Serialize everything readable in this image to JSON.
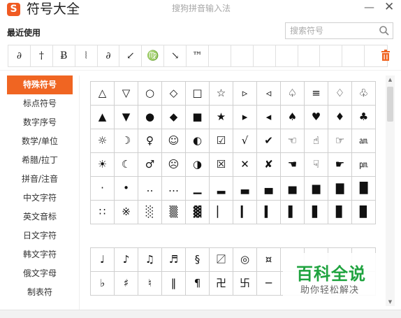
{
  "header": {
    "logo_letter": "S",
    "title": "符号大全",
    "ime_title": "搜狗拼音输入法",
    "minimize": "—",
    "close": "✕"
  },
  "recent": {
    "label": "最近使用",
    "items": [
      "∂",
      "†",
      "Ƀ",
      "⦚",
      "∂",
      "↙",
      "♍",
      "↘",
      "™",
      "",
      "",
      "",
      "",
      "",
      "",
      "",
      ""
    ]
  },
  "search": {
    "placeholder": "搜索符号",
    "value": ""
  },
  "sidebar": {
    "items": [
      {
        "label": "特殊符号",
        "active": true
      },
      {
        "label": "标点符号",
        "active": false
      },
      {
        "label": "数字序号",
        "active": false
      },
      {
        "label": "数学/单位",
        "active": false
      },
      {
        "label": "希腊/拉丁",
        "active": false
      },
      {
        "label": "拼音/注音",
        "active": false
      },
      {
        "label": "中文字符",
        "active": false
      },
      {
        "label": "英文音标",
        "active": false
      },
      {
        "label": "日文字符",
        "active": false
      },
      {
        "label": "韩文字符",
        "active": false
      },
      {
        "label": "俄文字母",
        "active": false
      },
      {
        "label": "制表符",
        "active": false
      }
    ]
  },
  "grid1": [
    "△",
    "▽",
    "○",
    "◇",
    "□",
    "☆",
    "▹",
    "◃",
    "♤",
    "≡",
    "♢",
    "♧",
    "▲",
    "▼",
    "●",
    "◆",
    "■",
    "★",
    "▸",
    "◂",
    "♠",
    "♥",
    "♦",
    "♣",
    "☼",
    "☽",
    "♀",
    "☺",
    "◐",
    "☑",
    "√",
    "✔",
    "☜",
    "☝",
    "☞",
    "㏂",
    "☀",
    "☾",
    "♂",
    "☹",
    "◑",
    "☒",
    "✕",
    "✘",
    "☚",
    "☟",
    "☛",
    "㏘",
    "‧",
    "•",
    "‥",
    "…",
    "▁",
    "▂",
    "▃",
    "▄",
    "▅",
    "▆",
    "▇",
    "█",
    "∷",
    "※",
    "░",
    "▒",
    "▓",
    "▏",
    "▎",
    "▍",
    "▌",
    "▋",
    "▊",
    "▉"
  ],
  "grid2": [
    "♩",
    "♪",
    "♫",
    "♬",
    "§",
    "〼",
    "◎",
    "¤",
    "",
    "",
    "",
    "",
    "♭",
    "♯",
    "♮",
    "‖",
    "¶",
    "卍",
    "卐",
    "─",
    "",
    "",
    "",
    ""
  ],
  "watermark": {
    "main": "百科全说",
    "sub": "助你轻松解决"
  },
  "colors": {
    "accent": "#f06522",
    "watermark_green": "#1fa33f"
  }
}
